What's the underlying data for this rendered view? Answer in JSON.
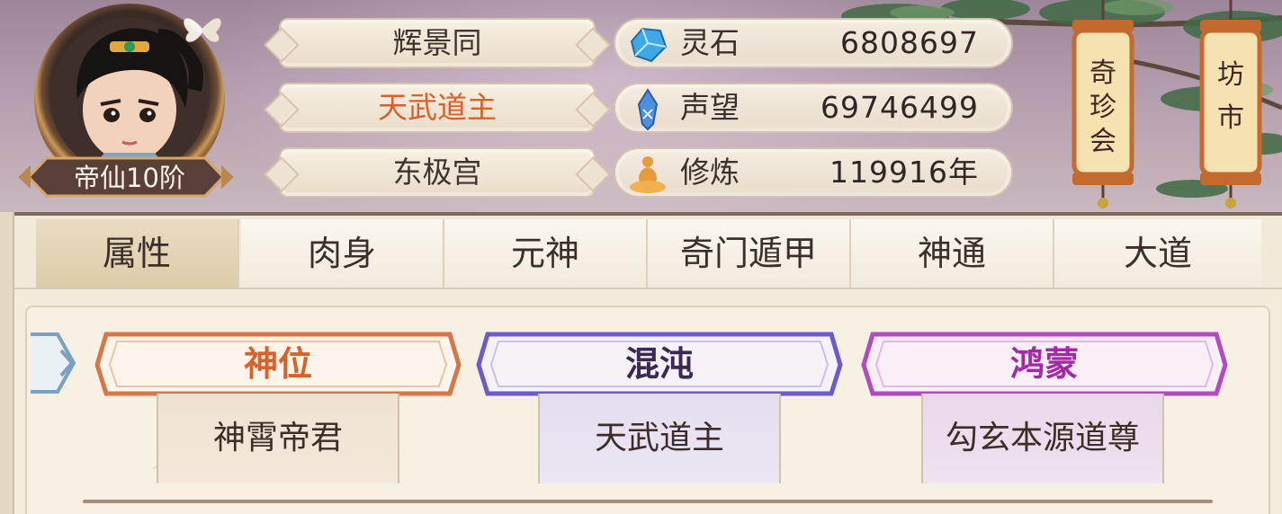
{
  "player": {
    "name": "辉景同",
    "title": "天武道主",
    "sect": "东极宫",
    "rank": "帝仙10阶"
  },
  "stats": [
    {
      "icon": "spirit-stone-icon",
      "label": "灵石",
      "value": "6808697"
    },
    {
      "icon": "reputation-crystal-icon",
      "label": "声望",
      "value": "69746499"
    },
    {
      "icon": "cultivation-meditation-icon",
      "label": "修炼",
      "value": "119916年"
    }
  ],
  "lanterns": {
    "left": [
      "奇",
      "珍",
      "会"
    ],
    "right": [
      "坊",
      "市"
    ]
  },
  "tabs": [
    "属性",
    "肉身",
    "元神",
    "奇门遁甲",
    "神通",
    "大道"
  ],
  "active_tab": "属性",
  "cards": [
    {
      "header": "神位",
      "value": "神霄帝君",
      "color": "#d9622b"
    },
    {
      "header": "混沌",
      "value": "天武道主",
      "color": "#3a2a52"
    },
    {
      "header": "鸿蒙",
      "value": "勾玄本源道尊",
      "color": "#a22aa8"
    }
  ]
}
